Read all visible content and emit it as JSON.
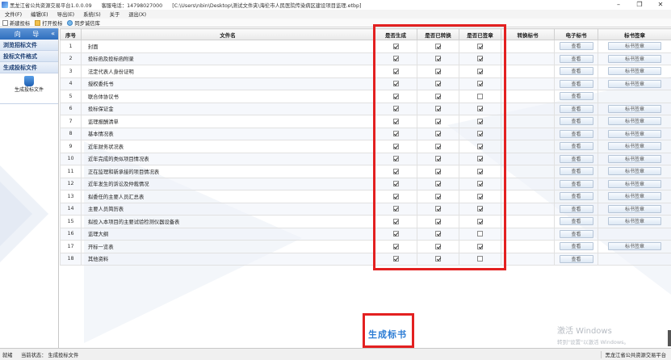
{
  "window": {
    "app_title": "黑龙江省公共资源交易平台1.0.0.09",
    "phone": "客服电话：14798027000",
    "file_path": "[C:\\Users\\nbin\\Desktop\\测试文件夹\\海伦市人民医院传染病区建设项目监理.etbp]",
    "minimize": "–",
    "maximize": "❐",
    "close": "✕"
  },
  "menu": {
    "items": [
      "文件(F)",
      "编辑(E)",
      "导出(E)",
      "系统(S)",
      "关于",
      "退出(X)"
    ]
  },
  "toolbar": {
    "new_label": "新建投标",
    "open_label": "打开投标",
    "sync_label": "同步诚信库"
  },
  "sidebar": {
    "header": "向 导",
    "collapse": "«",
    "items": [
      "浏览招标文件",
      "投标文件格式",
      "生成投标文件"
    ],
    "sub_item": "生成投标文件"
  },
  "grid": {
    "columns": [
      "序号",
      "文件名",
      "是否生成",
      "是否已转换",
      "是否已签章",
      "转换标书",
      "电子标书",
      "标书签章"
    ],
    "view_label": "查看",
    "sign_label": "标书签章",
    "rows": [
      {
        "no": "1",
        "name": "封面",
        "gen": true,
        "conv": true,
        "sig": true,
        "sign_btn": true
      },
      {
        "no": "2",
        "name": "投标函及投标函附录",
        "gen": true,
        "conv": true,
        "sig": true,
        "sign_btn": true
      },
      {
        "no": "3",
        "name": "法定代表人身份证明",
        "gen": true,
        "conv": true,
        "sig": true,
        "sign_btn": true
      },
      {
        "no": "4",
        "name": "授权委托书",
        "gen": true,
        "conv": true,
        "sig": true,
        "sign_btn": true
      },
      {
        "no": "5",
        "name": "联合体协议书",
        "gen": true,
        "conv": true,
        "sig": false,
        "sign_btn": false
      },
      {
        "no": "6",
        "name": "投标保证金",
        "gen": true,
        "conv": true,
        "sig": true,
        "sign_btn": true
      },
      {
        "no": "7",
        "name": "监理报酬清单",
        "gen": true,
        "conv": true,
        "sig": true,
        "sign_btn": true
      },
      {
        "no": "8",
        "name": "基本情况表",
        "gen": true,
        "conv": true,
        "sig": true,
        "sign_btn": true
      },
      {
        "no": "9",
        "name": "近年财务状况表",
        "gen": true,
        "conv": true,
        "sig": true,
        "sign_btn": true
      },
      {
        "no": "10",
        "name": "近年完成的类似项目情况表",
        "gen": true,
        "conv": true,
        "sig": true,
        "sign_btn": true
      },
      {
        "no": "11",
        "name": "正在监理和新承接的项目情况表",
        "gen": true,
        "conv": true,
        "sig": true,
        "sign_btn": true
      },
      {
        "no": "12",
        "name": "近年发生的诉讼及仲裁情况",
        "gen": true,
        "conv": true,
        "sig": true,
        "sign_btn": true
      },
      {
        "no": "13",
        "name": "拟委任的主要人员汇总表",
        "gen": true,
        "conv": true,
        "sig": true,
        "sign_btn": true
      },
      {
        "no": "14",
        "name": "主要人员简历表",
        "gen": true,
        "conv": true,
        "sig": true,
        "sign_btn": true
      },
      {
        "no": "15",
        "name": "拟投入本项目的主要试验检测仪器设备表",
        "gen": true,
        "conv": true,
        "sig": true,
        "sign_btn": true
      },
      {
        "no": "16",
        "name": "监理大纲",
        "gen": true,
        "conv": true,
        "sig": false,
        "sign_btn": false
      },
      {
        "no": "17",
        "name": "开标一览表",
        "gen": true,
        "conv": true,
        "sig": true,
        "sign_btn": true
      },
      {
        "no": "18",
        "name": "其他资料",
        "gen": true,
        "conv": true,
        "sig": false,
        "sign_btn": false
      }
    ]
  },
  "generate_button": "生成标书",
  "watermark": {
    "line1": "激活 Windows",
    "line2": "转到\"设置\"以激活 Windows。"
  },
  "status": {
    "ready": "就绪",
    "state": "当前状态： 生成投标文件",
    "right": "黑龙江省公共资源交易平台"
  },
  "colors": {
    "highlight": "#e32020",
    "accent": "#2a7bd4",
    "nav_header": "#2f6fbe"
  }
}
